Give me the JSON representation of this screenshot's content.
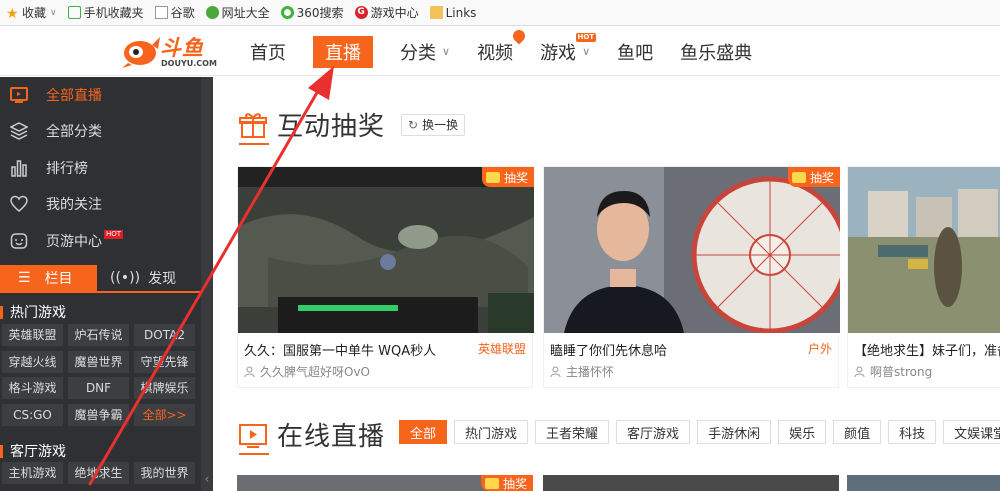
{
  "bookmarks": [
    {
      "label": "收藏",
      "icon": "star-icon"
    },
    {
      "label": "手机收藏夹",
      "icon": "phone-icon"
    },
    {
      "label": "谷歌",
      "icon": "page-icon"
    },
    {
      "label": "网址大全",
      "icon": "globe-icon"
    },
    {
      "label": "360搜索",
      "icon": "search-360-icon"
    },
    {
      "label": "游戏中心",
      "icon": "game-center-icon"
    },
    {
      "label": "Links",
      "icon": "folder-icon"
    }
  ],
  "logo": {
    "text": "斗鱼",
    "sub": "DOUYU.COM"
  },
  "nav": [
    {
      "label": "首页"
    },
    {
      "label": "直播",
      "active": true
    },
    {
      "label": "分类"
    },
    {
      "label": "视频"
    },
    {
      "label": "游戏",
      "badge": "HOT"
    },
    {
      "label": "鱼吧"
    },
    {
      "label": "鱼乐盛典"
    }
  ],
  "sidebar": {
    "items": [
      {
        "label": "全部直播",
        "icon": "tv-icon",
        "active": true
      },
      {
        "label": "全部分类",
        "icon": "layers-icon"
      },
      {
        "label": "排行榜",
        "icon": "bar-chart-icon"
      },
      {
        "label": "我的关注",
        "icon": "heart-icon"
      },
      {
        "label": "页游中心",
        "icon": "game-face-icon",
        "badge": "HOT"
      }
    ],
    "tabs": {
      "lanmu": "栏目",
      "faxian": "发现"
    },
    "hot_games_title": "热门游戏",
    "hot_games": [
      "英雄联盟",
      "炉石传说",
      "DOTA2",
      "穿越火线",
      "魔兽世界",
      "守望先锋",
      "格斗游戏",
      "DNF",
      "棋牌娱乐",
      "CS:GO",
      "魔兽争霸",
      "全部>>"
    ],
    "lobby_title": "客厅游戏",
    "lobby_games": [
      "主机游戏",
      "绝地求生",
      "我的世界"
    ]
  },
  "lottery": {
    "title": "互动抽奖",
    "refresh": "换一换",
    "cards": [
      {
        "badge": "抽奖",
        "title": "久久：国服第一中单牛 WQA秒人",
        "category": "英雄联盟",
        "user": "久久脾气超好呀OvO"
      },
      {
        "badge": "抽奖",
        "title": "瞌睡了你们先休息哈",
        "category": "户外",
        "user": "主播怀怀"
      },
      {
        "badge": "抽奖",
        "title": "【绝地求生】妹子们，准备",
        "category": "",
        "user": "啊普strong"
      }
    ]
  },
  "live": {
    "title": "在线直播",
    "filters": [
      "全部",
      "热门游戏",
      "王者荣耀",
      "客厅游戏",
      "手游休闲",
      "娱乐",
      "颜值",
      "科技",
      "文娱课堂"
    ],
    "first_badge": "抽奖"
  },
  "colors": {
    "accent": "#f7641c",
    "sidebar_bg": "#2f3033",
    "annotation_arrow": "#e8302f"
  }
}
